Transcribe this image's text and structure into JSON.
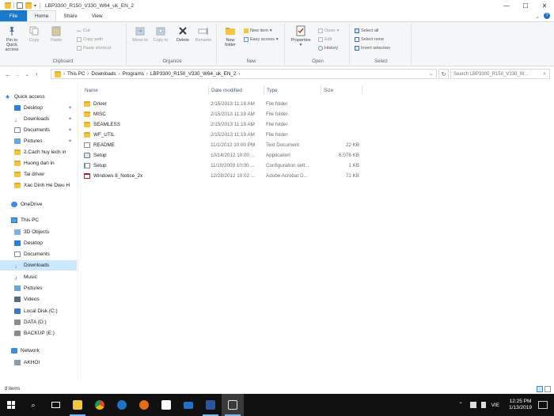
{
  "window": {
    "title": "LBP3300_R150_V330_W64_uk_EN_2",
    "buttons": {
      "minimize": "—",
      "maximize": "☐",
      "close": "✕"
    }
  },
  "tabs": [
    "File",
    "Home",
    "Share",
    "View"
  ],
  "active_tab": "Home",
  "ribbon": {
    "clipboard": {
      "label": "Clipboard",
      "pin": "Pin to Quick access",
      "copy": "Copy",
      "paste": "Paste",
      "cut": "Cut",
      "copy_path": "Copy path",
      "paste_shortcut": "Paste shortcut"
    },
    "organize": {
      "label": "Organize",
      "move_to": "Move to",
      "copy_to": "Copy to",
      "delete": "Delete",
      "rename": "Rename"
    },
    "new": {
      "label": "New",
      "new_folder": "New folder",
      "new_item": "New item",
      "easy_access": "Easy access"
    },
    "open": {
      "label": "Open",
      "properties": "Properties",
      "open": "Open",
      "edit": "Edit",
      "history": "History"
    },
    "select": {
      "label": "Select",
      "select_all": "Select all",
      "select_none": "Select none",
      "invert_selection": "Invert selection"
    }
  },
  "address": {
    "crumbs": [
      "This PC",
      "Downloads",
      "Programs",
      "LBP3300_R150_V330_W64_uk_EN_2"
    ],
    "search_placeholder": "Search LBP3300_R150_V330_W..."
  },
  "nav": {
    "quick_access": {
      "label": "Quick access",
      "items": [
        "Desktop",
        "Downloads",
        "Documents",
        "Pictures",
        "2.Cach huy lech in",
        "Huong dan in",
        "Tai driver",
        "Xac Dinh He Dieu H"
      ]
    },
    "onedrive": "OneDrive",
    "this_pc": {
      "label": "This PC",
      "items": [
        "3D Objects",
        "Desktop",
        "Documents",
        "Downloads",
        "Music",
        "Pictures",
        "Videos",
        "Local Disk (C:)",
        "DATA (D:)",
        "BACKUP (E:)"
      ]
    },
    "network": {
      "label": "Network",
      "items": [
        "AKHOI"
      ]
    },
    "selected": "Downloads"
  },
  "columns": {
    "name": "Name",
    "date": "Date modified",
    "type": "Type",
    "size": "Size"
  },
  "files": [
    {
      "name": "Driver",
      "date": "2/15/2013 11:19 AM",
      "type": "File folder",
      "size": "",
      "icon": "folder-icon"
    },
    {
      "name": "MISC",
      "date": "2/15/2013 11:19 AM",
      "type": "File folder",
      "size": "",
      "icon": "folder-icon"
    },
    {
      "name": "SEAMLESS",
      "date": "2/15/2013 11:19 AM",
      "type": "File folder",
      "size": "",
      "icon": "folder-icon"
    },
    {
      "name": "WF_UTIL",
      "date": "2/15/2013 11:19 AM",
      "type": "File folder",
      "size": "",
      "icon": "folder-icon"
    },
    {
      "name": "README",
      "date": "11/1/2012 10:00 PM",
      "type": "Text Document",
      "size": "22 KB",
      "icon": "text-file-icon"
    },
    {
      "name": "Setup",
      "date": "10/14/2012 10:00 ...",
      "type": "Application",
      "size": "6,076 KB",
      "icon": "application-icon"
    },
    {
      "name": "Setup",
      "date": "11/10/2009 10:00 ...",
      "type": "Configuration sett...",
      "size": "1 KB",
      "icon": "config-file-icon"
    },
    {
      "name": "Windows 8_Notice_2x",
      "date": "12/28/2012 10:02 ...",
      "type": "Adobe Acrobat D...",
      "size": "72 KB",
      "icon": "pdf-icon"
    }
  ],
  "status": {
    "items": "8 items"
  },
  "taskbar": {
    "apps": [
      "search-icon",
      "task-view-icon",
      "file-explorer-icon",
      "chrome-icon",
      "edge-icon",
      "firefox-icon",
      "store-icon",
      "mail-icon",
      "word-icon",
      "photos-icon"
    ],
    "time": "12:25 PM",
    "date": "1/13/2019",
    "lang": "VIE"
  }
}
